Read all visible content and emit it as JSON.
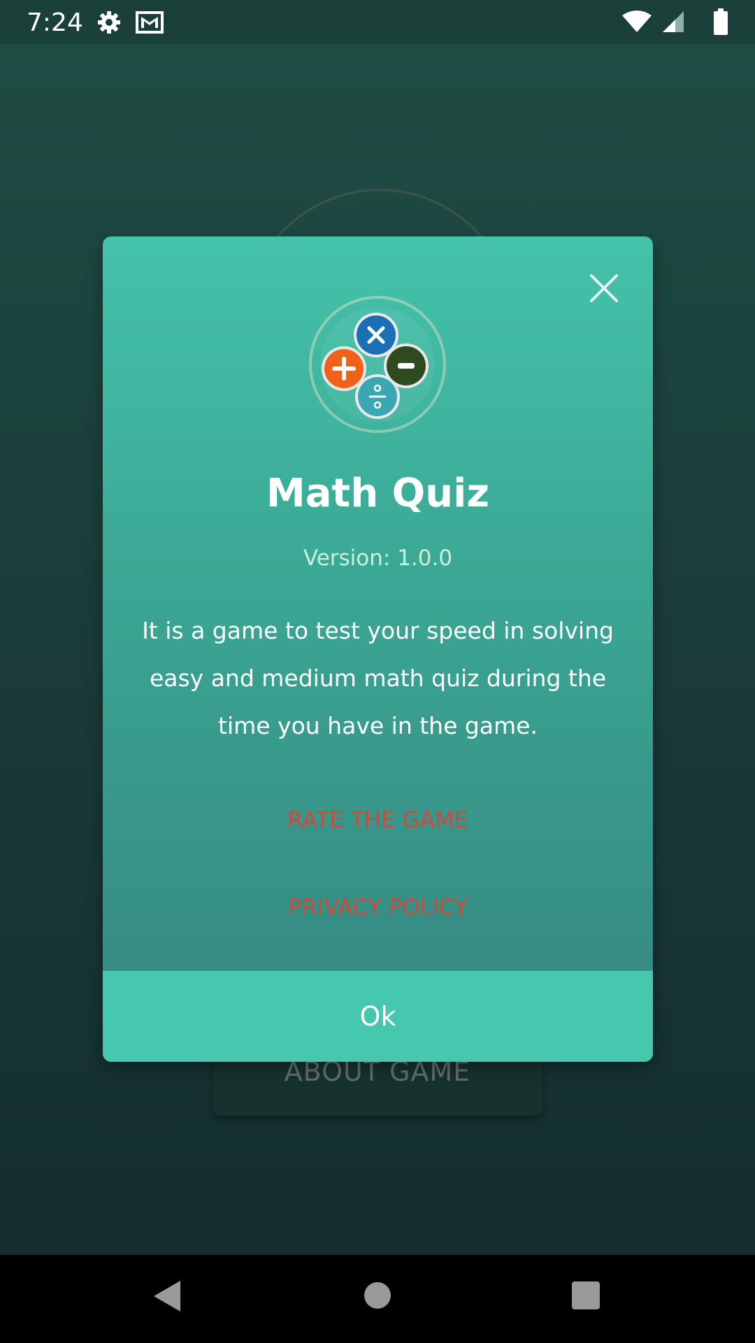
{
  "status_bar": {
    "time": "7:24",
    "left_icons": [
      "gear-icon",
      "mail-icon"
    ],
    "right_icons": [
      "wifi-icon",
      "cell-signal-icon",
      "battery-icon"
    ]
  },
  "background": {
    "about_button_label": "ABOUT GAME"
  },
  "dialog": {
    "title": "Math Quiz",
    "version": "Version: 1.0.0",
    "description": "It is a game to test your speed in solving easy and medium math quiz during the time you have in the game.",
    "rate_label": "RATE THE GAME",
    "privacy_label": "PRIVACY POLICY",
    "ok_label": "Ok",
    "close_icon": "close-icon",
    "logo_icon": "math-operators-logo-icon"
  },
  "colors": {
    "dialog_top": "#44c2aa",
    "dialog_bottom": "#358580",
    "ok_button": "#45c8ae",
    "link": "#cf4a3b",
    "version_text": "#c9f0d8"
  },
  "nav_bar": {
    "icons": [
      "back-icon",
      "home-icon",
      "recents-icon"
    ]
  }
}
